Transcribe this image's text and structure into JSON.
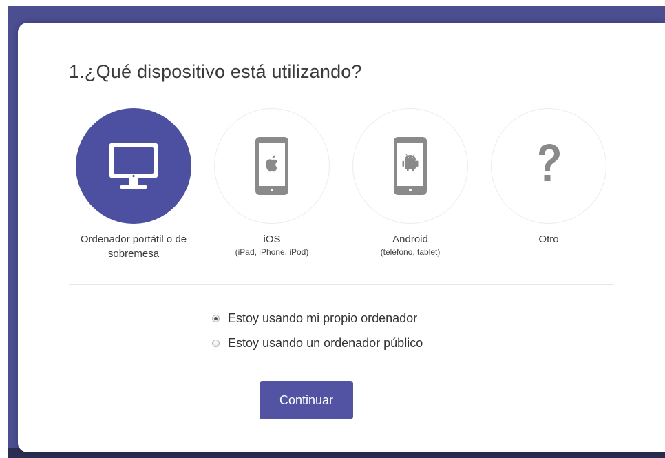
{
  "dialog": {
    "title": "1.¿Qué dispositivo está utilizando?"
  },
  "devices": [
    {
      "label": "Ordenador portátil o de",
      "label2": "sobremesa",
      "sub": "",
      "icon": "desktop-monitor-icon",
      "selected": true
    },
    {
      "label": "iOS",
      "label2": "",
      "sub": "(iPad, iPhone, iPod)",
      "icon": "apple-tablet-icon",
      "selected": false
    },
    {
      "label": "Android",
      "label2": "",
      "sub": "(teléfono, tablet)",
      "icon": "android-tablet-icon",
      "selected": false
    },
    {
      "label": "Otro",
      "label2": "",
      "sub": "",
      "icon": "question-mark-icon",
      "selected": false
    }
  ],
  "computer_type": {
    "options": [
      {
        "label": "Estoy usando mi propio ordenador",
        "checked": true
      },
      {
        "label": "Estoy usando un ordenador público",
        "checked": false
      }
    ]
  },
  "actions": {
    "continue_label": "Continuar"
  },
  "colors": {
    "accent": "#4d4fa0",
    "backdrop": "#4c4e92",
    "icon_gray": "#8a8a8a"
  }
}
